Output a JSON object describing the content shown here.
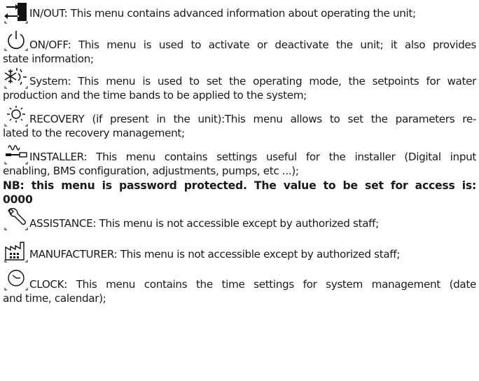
{
  "entries": {
    "inout": {
      "label": "IN/OUT: This menu contains advanced information about operating the unit;"
    },
    "onoff": {
      "line1": "ON/OFF: This menu is used to activate or deactivate the unit; it also provides",
      "line2": "state information;"
    },
    "system": {
      "line1": "System: This menu is used to set the operating mode, the setpoints for water",
      "line2": "production and the time bands to be applied to the system;"
    },
    "recovery": {
      "line1": "RECOVERY (if present in the unit):This menu allows to set the parameters re-",
      "line2": "lated to the recovery management;"
    },
    "installer": {
      "line1": "INSTALLER: This menu contains settings useful for the installer (Digital input",
      "line2": "enabling, BMS configuration, adjustments, pumps, etc ...);"
    },
    "nb": {
      "line1": "NB: this menu is password protected. The value to be set for access is:",
      "line2": "0000"
    },
    "assistance": {
      "label": "ASSISTANCE: This menu is not accessible except by authorized staff;"
    },
    "manufacturer": {
      "label": "MANUFACTURER: This menu is not accessible except by authorized staff;"
    },
    "clock": {
      "line1": "CLOCK: This menu contains the time settings for system management (date",
      "line2": "and time, calendar);"
    }
  },
  "icons": [
    "in-out-icon",
    "power-icon",
    "system-snow-sun-icon",
    "recovery-sun-icon",
    "installer-wrench-heater-icon",
    "assistance-wrench-icon",
    "manufacturer-factory-icon",
    "clock-icon"
  ]
}
